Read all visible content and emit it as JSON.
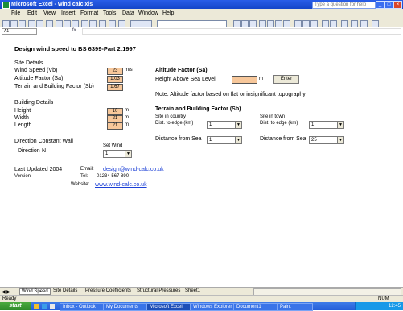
{
  "window": {
    "title": "Microsoft Excel - wind calc.xls",
    "help_placeholder": "Type a question for help"
  },
  "menu": [
    "File",
    "Edit",
    "View",
    "Insert",
    "Format",
    "Tools",
    "Data",
    "Window",
    "Help"
  ],
  "formula_bar": {
    "name_box": "A1"
  },
  "sheet": {
    "title": "Design wind speed to BS 6399-Part 2:1997",
    "site_details": {
      "heading": "Site Details",
      "rows": [
        {
          "label": "Wind Speed (Vb)",
          "value": "23",
          "unit": "m/s"
        },
        {
          "label": "Altitude Factor (Sa)",
          "value": "1.03",
          "unit": ""
        },
        {
          "label": "Terrain and Building Factor (Sb)",
          "value": "1.67",
          "unit": ""
        }
      ]
    },
    "building_details": {
      "heading": "Building Details",
      "rows": [
        {
          "label": "Height",
          "value": "10",
          "unit": "m"
        },
        {
          "label": "Width",
          "value": "21",
          "unit": "m"
        },
        {
          "label": "Length",
          "value": "21",
          "unit": "m"
        }
      ]
    },
    "orientation": {
      "heading": "Direction Constant Wall",
      "label": "Direction",
      "value": "N",
      "dropdown_label": "Set Wind",
      "dropdown_value": "1"
    },
    "altitude": {
      "heading": "Altitude Factor (Sa)",
      "site_label": "Height Above Sea Level",
      "unit": "m",
      "button": "Enter",
      "note": "Note: Altitude factor based on flat or insignificant topography"
    },
    "terrain": {
      "heading": "Terrain and Building Factor (Sb)",
      "left_label": "Site in country",
      "left_sub": "Dist. to edge (km)",
      "left_value": "1",
      "right_label": "Site in town",
      "right_sub": "Dist. to edge (km)",
      "right_value": "1",
      "dist_left_label": "Distance from Sea",
      "dist_left_value": "1",
      "dist_right_label": "Distance from Sea",
      "dist_right_value": "25"
    },
    "footer": {
      "date_label": "Last Updated 2004",
      "ver_label": "Version",
      "email_label": "Email:",
      "email": "design@wind-calc.co.uk",
      "tel_label": "Tel:",
      "tel": "01234 567 890",
      "web_label": "Website:",
      "web": "www.wind-calc.co.uk"
    }
  },
  "sheet_tabs": [
    "Wind Speed",
    "Site Details",
    "Pressure Coefficients",
    "Structural Pressures",
    "Sheet1"
  ],
  "status": {
    "left": "Ready",
    "right": "NUM"
  },
  "taskbar": {
    "start": "start",
    "buttons": [
      "Inbox - Outlook",
      "My Documents",
      "Microsoft Excel",
      "Windows Explorer",
      "Document1",
      "Paint"
    ],
    "clock": "12:45"
  }
}
